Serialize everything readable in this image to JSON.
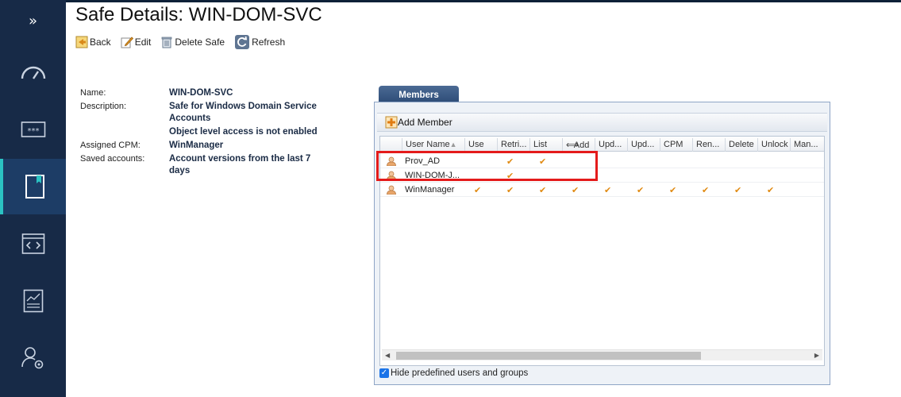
{
  "app": {
    "title": "Safe Details: WIN-DOM-SVC",
    "accent": "#2bc3c3",
    "sidebar_bg": "#172a47"
  },
  "sidebar": {
    "expand_glyph": "»",
    "items": [
      {
        "icon": "dashboard-gauge-icon"
      },
      {
        "icon": "password-field-icon"
      },
      {
        "icon": "bookmark-policies-icon",
        "active": true
      },
      {
        "icon": "code-window-icon"
      },
      {
        "icon": "report-chart-icon"
      },
      {
        "icon": "user-settings-icon"
      }
    ]
  },
  "toolbar": {
    "back_label": "Back",
    "edit_label": "Edit",
    "delete_label": "Delete Safe",
    "refresh_label": "Refresh"
  },
  "details": {
    "name_label": "Name:",
    "name_value": "WIN-DOM-SVC",
    "description_label": "Description:",
    "description_value": "Safe for Windows Domain Service Accounts",
    "access_note": "Object level access is not enabled",
    "cpm_label": "Assigned CPM:",
    "cpm_value": "WinManager",
    "saved_label": "Saved accounts:",
    "saved_value": "Account versions from the last 7 days"
  },
  "members": {
    "tab_label": "Members",
    "add_member_label": "Add Member",
    "columns": [
      "User Name",
      "Use",
      "Retri...",
      "List",
      "Add",
      "Upd...",
      "Upd...",
      "CPM",
      "Ren...",
      "Delete",
      "Unlock",
      "Man..."
    ],
    "sort_indicator": "▲",
    "rows": [
      {
        "name": "Prov_AD",
        "checks": [
          false,
          true,
          true,
          false,
          false,
          false,
          false,
          false,
          false,
          false,
          false
        ]
      },
      {
        "name": "WIN-DOM-J...",
        "checks": [
          false,
          true,
          false,
          false,
          false,
          false,
          false,
          false,
          false,
          false,
          false
        ]
      },
      {
        "name": "WinManager",
        "checks": [
          true,
          true,
          true,
          true,
          true,
          true,
          true,
          true,
          true,
          true,
          false
        ]
      }
    ],
    "check_glyph": "✔",
    "hide_predefined_label": "Hide predefined users and groups",
    "hide_predefined_checked": true
  }
}
